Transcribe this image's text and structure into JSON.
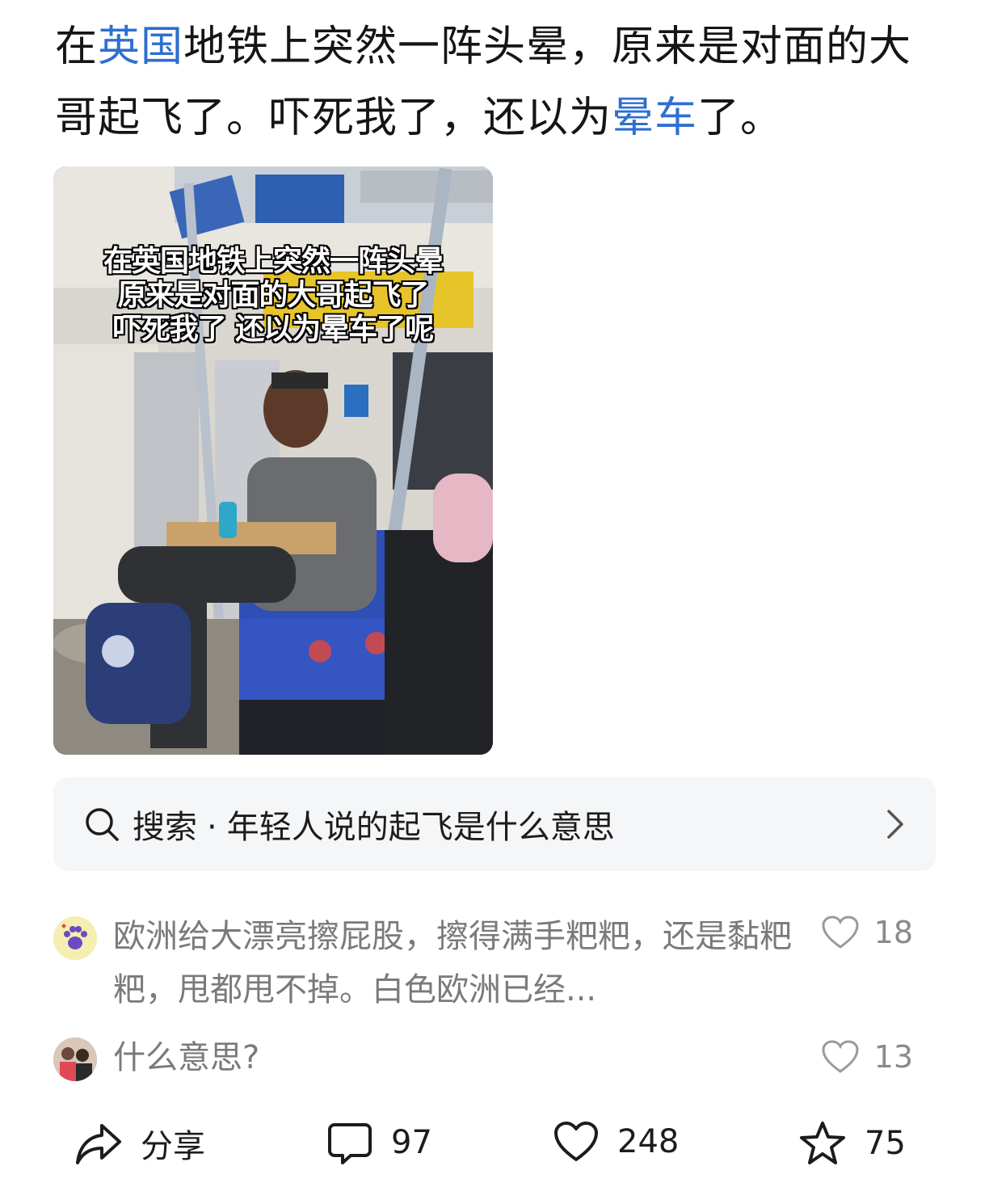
{
  "post": {
    "title_parts": [
      {
        "text": "在",
        "link": false
      },
      {
        "text": "英国",
        "link": true
      },
      {
        "text": "地铁上突然一阵头晕，原来是对面的大哥起飞了。吓死我了，还以为",
        "link": false
      },
      {
        "text": "晕车",
        "link": true
      },
      {
        "text": "了。",
        "link": false
      }
    ],
    "video_caption": [
      "在英国地铁上突然一阵头晕",
      "原来是对面的大哥起飞了",
      "吓死我了 还以为晕车了呢"
    ]
  },
  "search_card": {
    "prefix": "搜索",
    "separator": "·",
    "query": "年轻人说的起飞是什么意思"
  },
  "comments": [
    {
      "text": "欧洲给大漂亮擦屁股，擦得满手粑粑，还是黏粑粑，甩都甩不掉。白色欧洲已经...",
      "likes": "18"
    },
    {
      "text": "什么意思?",
      "likes": "13"
    }
  ],
  "actions": {
    "share_label": "分享",
    "comments_count": "97",
    "likes_count": "248",
    "favorites_count": "75"
  },
  "colors": {
    "link": "#2f6fd0",
    "muted": "#7a7a7a"
  }
}
